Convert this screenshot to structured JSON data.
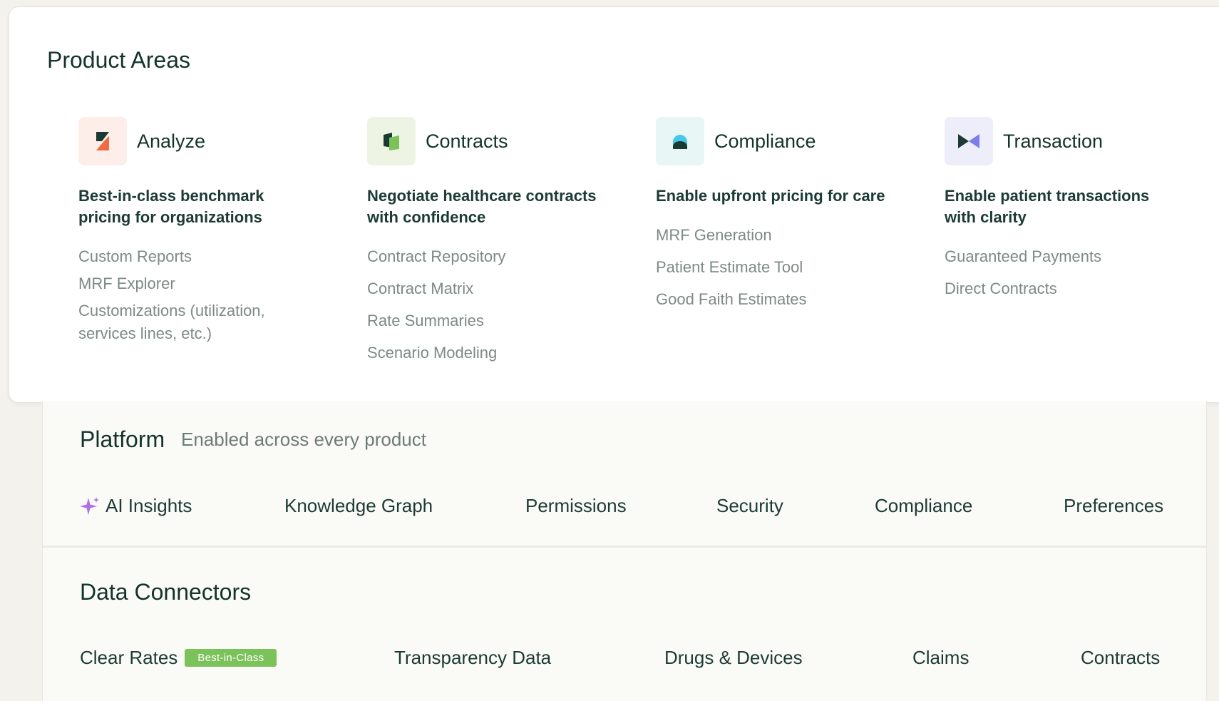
{
  "product_areas": {
    "title": "Product Areas",
    "areas": [
      {
        "name": "Analyze",
        "icon": "analyze-logo-icon",
        "tagline": "Best-in-class benchmark pricing for organizations",
        "features": [
          "Custom Reports",
          "MRF Explorer",
          "Customizations (utilization, services lines, etc.)"
        ]
      },
      {
        "name": "Contracts",
        "icon": "contracts-logo-icon",
        "tagline": "Negotiate healthcare contracts with confidence",
        "features": [
          "Contract Repository",
          "Contract Matrix",
          "Rate Summaries",
          "Scenario Modeling"
        ]
      },
      {
        "name": "Compliance",
        "icon": "compliance-logo-icon",
        "tagline": "Enable upfront pricing for care",
        "features": [
          "MRF Generation",
          "Patient Estimate Tool",
          "Good Faith Estimates"
        ]
      },
      {
        "name": "Transaction",
        "icon": "transaction-logo-icon",
        "tagline": "Enable patient transactions with clarity",
        "features": [
          "Guaranteed Payments",
          "Direct Contracts"
        ]
      }
    ]
  },
  "platform": {
    "title": "Platform",
    "subtitle": "Enabled across every product",
    "items": [
      "AI Insights",
      "Knowledge Graph",
      "Permissions",
      "Security",
      "Compliance",
      "Preferences"
    ]
  },
  "data_connectors": {
    "title": "Data Connectors",
    "items": [
      "Clear Rates",
      "Transparency Data",
      "Drugs & Devices",
      "Claims",
      "Contracts"
    ],
    "badge": "Best-in-Class"
  },
  "colors": {
    "text_dark": "#14332c",
    "text_muted": "#7d8a85",
    "badge_green": "#7cc25b",
    "sparkle_purple": "#b06ee8"
  }
}
